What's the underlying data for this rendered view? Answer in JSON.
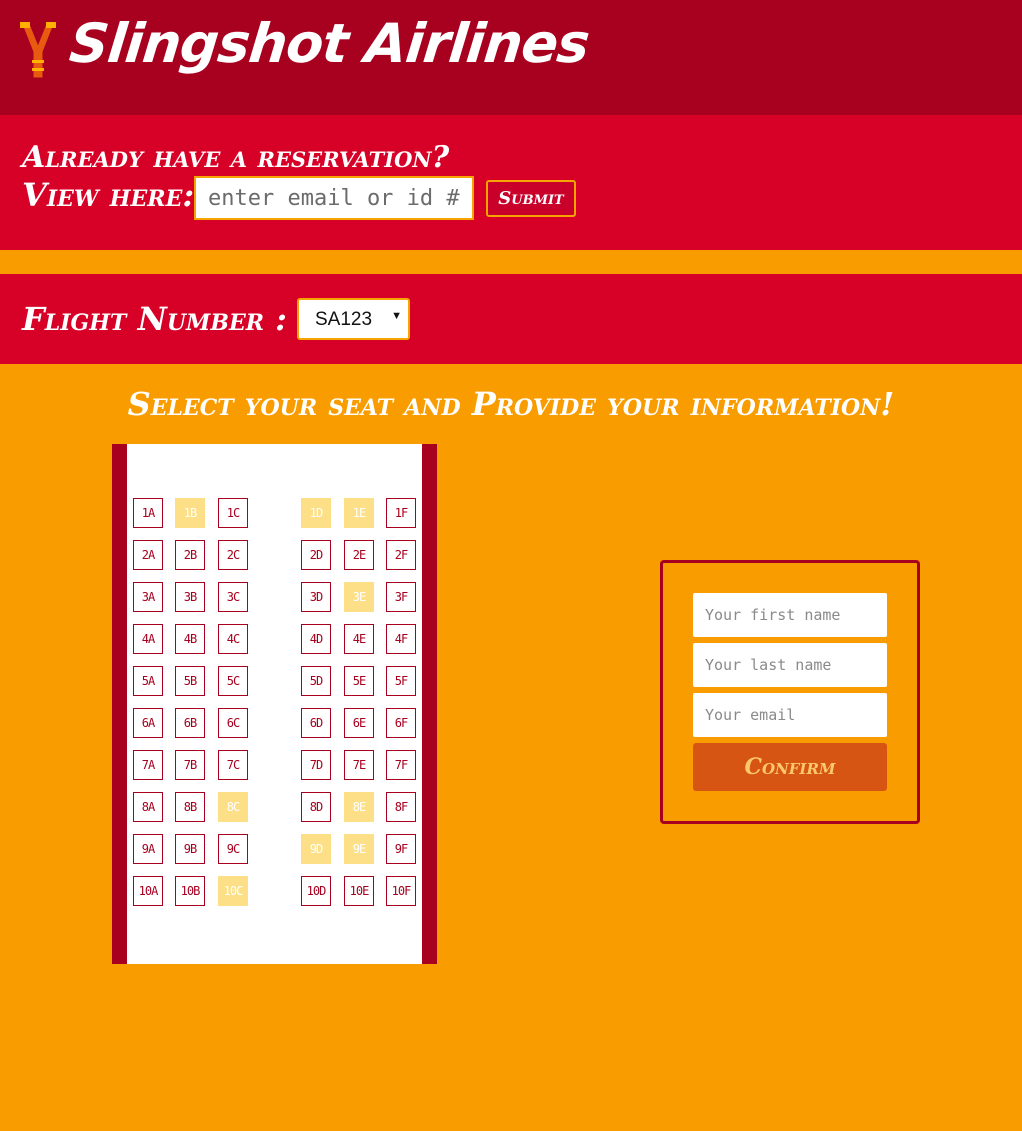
{
  "header": {
    "brand": "Slingshot Airlines",
    "logo_icon": "slingshot-icon"
  },
  "reservation": {
    "question": "Already have a reservation?",
    "view_label": "View here:",
    "input_placeholder": "enter email or id #",
    "submit_label": "Submit"
  },
  "flight": {
    "label": "Flight Number :",
    "selected": "SA123"
  },
  "seat_section_title": "Select your seat and Provide your information!",
  "seats": {
    "rows": [
      "1",
      "2",
      "3",
      "4",
      "5",
      "6",
      "7",
      "8",
      "9",
      "10"
    ],
    "columns": [
      "A",
      "B",
      "C",
      "D",
      "E",
      "F"
    ],
    "taken": [
      "1B",
      "1D",
      "1E",
      "3E",
      "8C",
      "8E",
      "9D",
      "9E",
      "10C"
    ]
  },
  "form": {
    "first_name_placeholder": "Your first name",
    "last_name_placeholder": "Your last name",
    "email_placeholder": "Your email",
    "confirm_label": "Confirm"
  },
  "colors": {
    "background": "#f89c00",
    "header": "#a8001f",
    "band": "#d70027",
    "seat_taken": "#fcdf86",
    "confirm": "#d65512"
  }
}
